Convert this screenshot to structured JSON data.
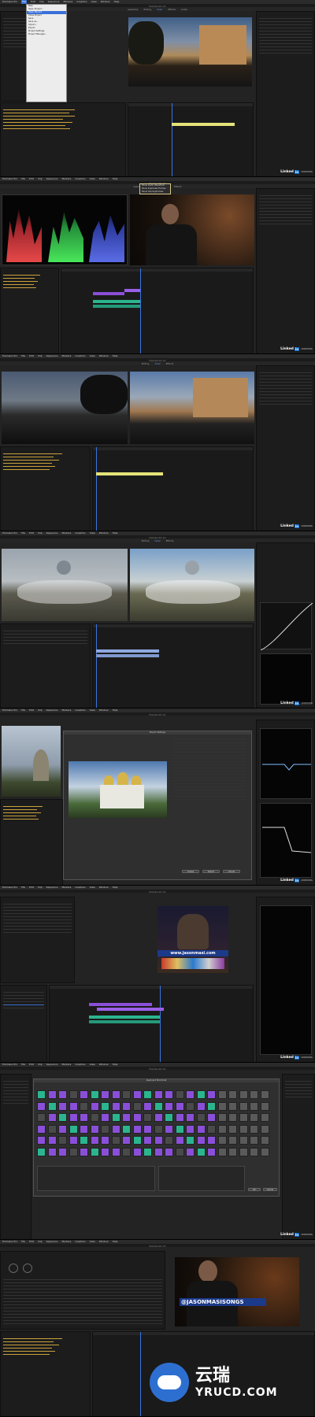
{
  "app": {
    "title": "Premiere Pro CC",
    "menus": [
      "Premiere Pro",
      "File",
      "Edit",
      "Clip",
      "Sequence",
      "Markers",
      "Graphics",
      "View",
      "Window",
      "Help"
    ],
    "workspaces": [
      "Assembly",
      "Editing",
      "Color",
      "Effects",
      "Audio",
      "Graphics",
      "Libraries"
    ],
    "active_workspace": "Color"
  },
  "frames": [
    {
      "id": 1,
      "context_menu": [
        "New",
        "Open Project...",
        "Open Recent",
        "Close Project",
        "Save",
        "Save As...",
        "Import...",
        "Export",
        "Project Settings",
        "Project Manager..."
      ],
      "highlight": "Open Recent"
    },
    {
      "id": 2,
      "context_menu_items": [
        "Show Audio Waveform",
        "Show Duplicate Frames",
        "Show Clip Keyframes"
      ]
    },
    {
      "id": 3
    },
    {
      "id": 4
    },
    {
      "id": 5,
      "dialog_title": "Export Settings",
      "dialog_buttons": [
        "Queue",
        "Export",
        "Cancel"
      ]
    },
    {
      "id": 6,
      "overlay": "www.jasonmasi.com"
    },
    {
      "id": 7,
      "dialog_title": "Keyboard Shortcuts",
      "dialog_buttons": [
        "OK",
        "Cancel"
      ]
    },
    {
      "id": 8,
      "overlay": "@JASONMASISONGS"
    }
  ],
  "branding": {
    "logo_word": "Linked",
    "logo_in": "in",
    "logo_suffix": "LEARNING",
    "watermark_cn": "云瑞",
    "watermark_url": "YRUCD.COM"
  },
  "colors": {
    "accent": "#3b75e0",
    "clip_purple": "#8a4fd8",
    "clip_teal": "#2bb58f",
    "clip_yellow": "#e4e27a"
  }
}
